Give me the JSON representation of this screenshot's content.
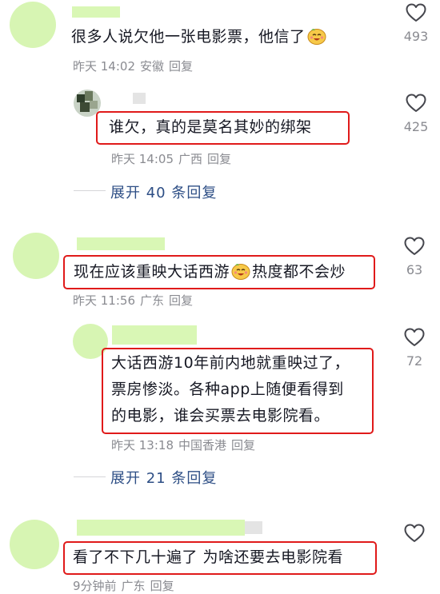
{
  "comments": [
    {
      "text": "很多人说欠他一张电影票，他信了",
      "time": "昨天 14:02",
      "location": "安徽",
      "reply_label": "回复",
      "likes": "493",
      "reply": {
        "text": "谁欠，真的是莫名其妙的绑架",
        "time": "昨天 14:05",
        "location": "广西",
        "reply_label": "回复",
        "likes": "425"
      },
      "expand_label": "展开 40 条回复"
    },
    {
      "text_before_emoji": "现在应该重映大话西游",
      "text_after_emoji": "热度都不会炒",
      "time": "昨天 11:56",
      "location": "广东",
      "reply_label": "回复",
      "likes": "63",
      "reply": {
        "lines": [
          "大话西游10年前内地就重映过了，",
          "票房惨淡。各种app上随便看得到",
          "的电影，谁会买票去电影院看。"
        ],
        "time": "昨天 13:18",
        "location": "中国香港",
        "reply_label": "回复",
        "likes": "72"
      },
      "expand_label": "展开 21 条回复"
    },
    {
      "text": "看了不下几十遍了 为啥还要去电影院看",
      "time": "9分钟前",
      "location": "广东",
      "reply_label": "回复",
      "likes": ""
    }
  ],
  "colors": {
    "highlight_box": "#e01a1a",
    "avatar_placeholder": "#d7f5b3",
    "meta_text": "#8a8b91",
    "expand_link": "#2d4e85"
  },
  "icons": {
    "like": "heart-outline-icon",
    "emoji": "laughing-face-emoji"
  }
}
